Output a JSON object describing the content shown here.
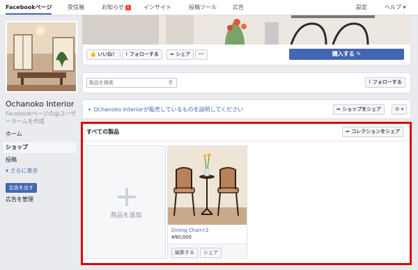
{
  "topnav": {
    "items": [
      {
        "label": "Facebookページ",
        "active": true
      },
      {
        "label": "受信箱"
      },
      {
        "label": "お知らせ",
        "badge": "1"
      },
      {
        "label": "インサイト"
      },
      {
        "label": "投稿ツール"
      },
      {
        "label": "広告"
      }
    ],
    "settings": "設定",
    "help": "ヘルプ ▾"
  },
  "page": {
    "name": "Ochanoko Interior",
    "username_prompt": "Facebookページの@ユーザーネームを作成"
  },
  "leftnav": {
    "home": "ホーム",
    "shop": "ショップ",
    "posts": "投稿",
    "more": "▾ さらに表示",
    "create_ad": "広告を出す",
    "manage_ads": "広告を管理"
  },
  "actions": {
    "like": "いいね！",
    "follow": "フォローする",
    "share": "シェア",
    "more": "···",
    "buy": "購入する ✎"
  },
  "shop_search": {
    "placeholder": "製品を検索",
    "follow": "フォローする"
  },
  "describe_bar": {
    "text": "+ Ochanoko Interiorが販売しているものを説明してください",
    "share": "ショップをシェア",
    "gear": "⚙ ▾"
  },
  "products_section": {
    "title": "すべての製品",
    "share_collection": "コレクションをシェア",
    "add_label": "商品を追加",
    "product": {
      "name": "Dining Chair×2",
      "price": "¥90,000",
      "edit": "編集する",
      "share": "シェア"
    }
  },
  "colors": {
    "brand": "#4267b2",
    "highlight": "#e00000",
    "background": "#e9ebee"
  }
}
